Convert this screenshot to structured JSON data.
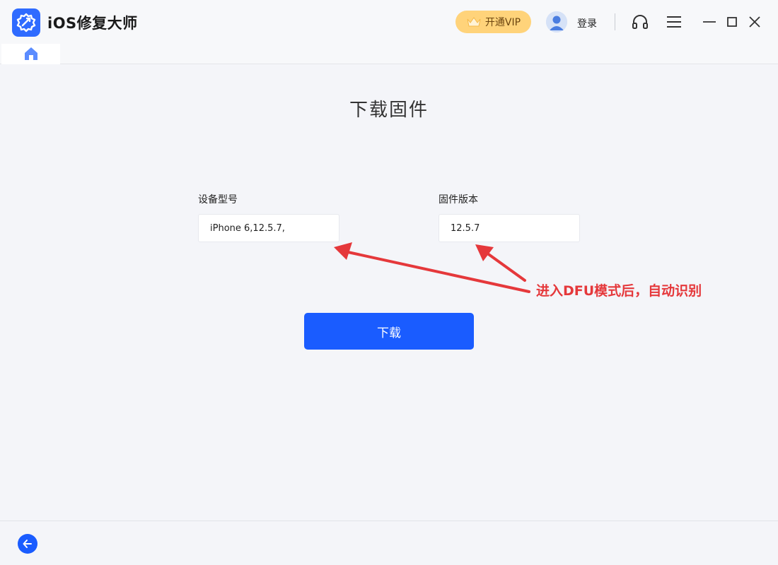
{
  "app": {
    "title": "iOS修复大师",
    "accent_color": "#1a5cff"
  },
  "header": {
    "vip_label": "开通VIP",
    "login_label": "登录",
    "icons": [
      "crown-icon",
      "avatar-icon",
      "headset-icon",
      "menu-icon",
      "minimize-icon",
      "maximize-icon",
      "close-icon"
    ]
  },
  "tabs": {
    "home_icon": "home-icon"
  },
  "main": {
    "title": "下载固件",
    "device_model_label": "设备型号",
    "device_model_value": "iPhone 6,12.5.7,",
    "firmware_version_label": "固件版本",
    "firmware_version_value": "12.5.7",
    "download_label": "下载",
    "annotation": "进入DFU模式后，自动识别",
    "annotation_color": "#e5383b"
  },
  "footer": {
    "back_icon": "arrow-left-icon"
  }
}
